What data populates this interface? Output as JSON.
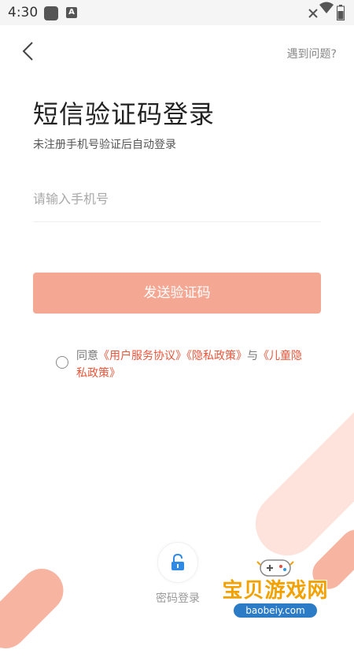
{
  "status_bar": {
    "time": "4:30",
    "icons": [
      "app-square-icon",
      "android-icon",
      "wifi-icon",
      "no-signal-icon",
      "battery-icon"
    ]
  },
  "header": {
    "back_icon": "chevron-left-icon",
    "help_label": "遇到问题?"
  },
  "main": {
    "title": "短信验证码登录",
    "subtitle": "未注册手机号验证后自动登录",
    "phone_placeholder": "请输入手机号",
    "phone_value": "",
    "send_code_label": "发送验证码"
  },
  "agreement": {
    "prefix": "同意",
    "user_agreement": "《用户服务协议》",
    "privacy_policy": "《隐私政策》",
    "conjunction": "与",
    "children_privacy": "《儿童隐私政策》",
    "checked": false
  },
  "footer": {
    "password_login_label": "密码登录",
    "password_login_icon": "lock-icon"
  },
  "watermark": {
    "title": "宝贝游戏网",
    "url": "baobeiy.com"
  },
  "colors": {
    "accent": "#f4a894",
    "link": "#e8553a",
    "lock_blue": "#2f8ae6",
    "watermark_orange": "#f2a100"
  }
}
